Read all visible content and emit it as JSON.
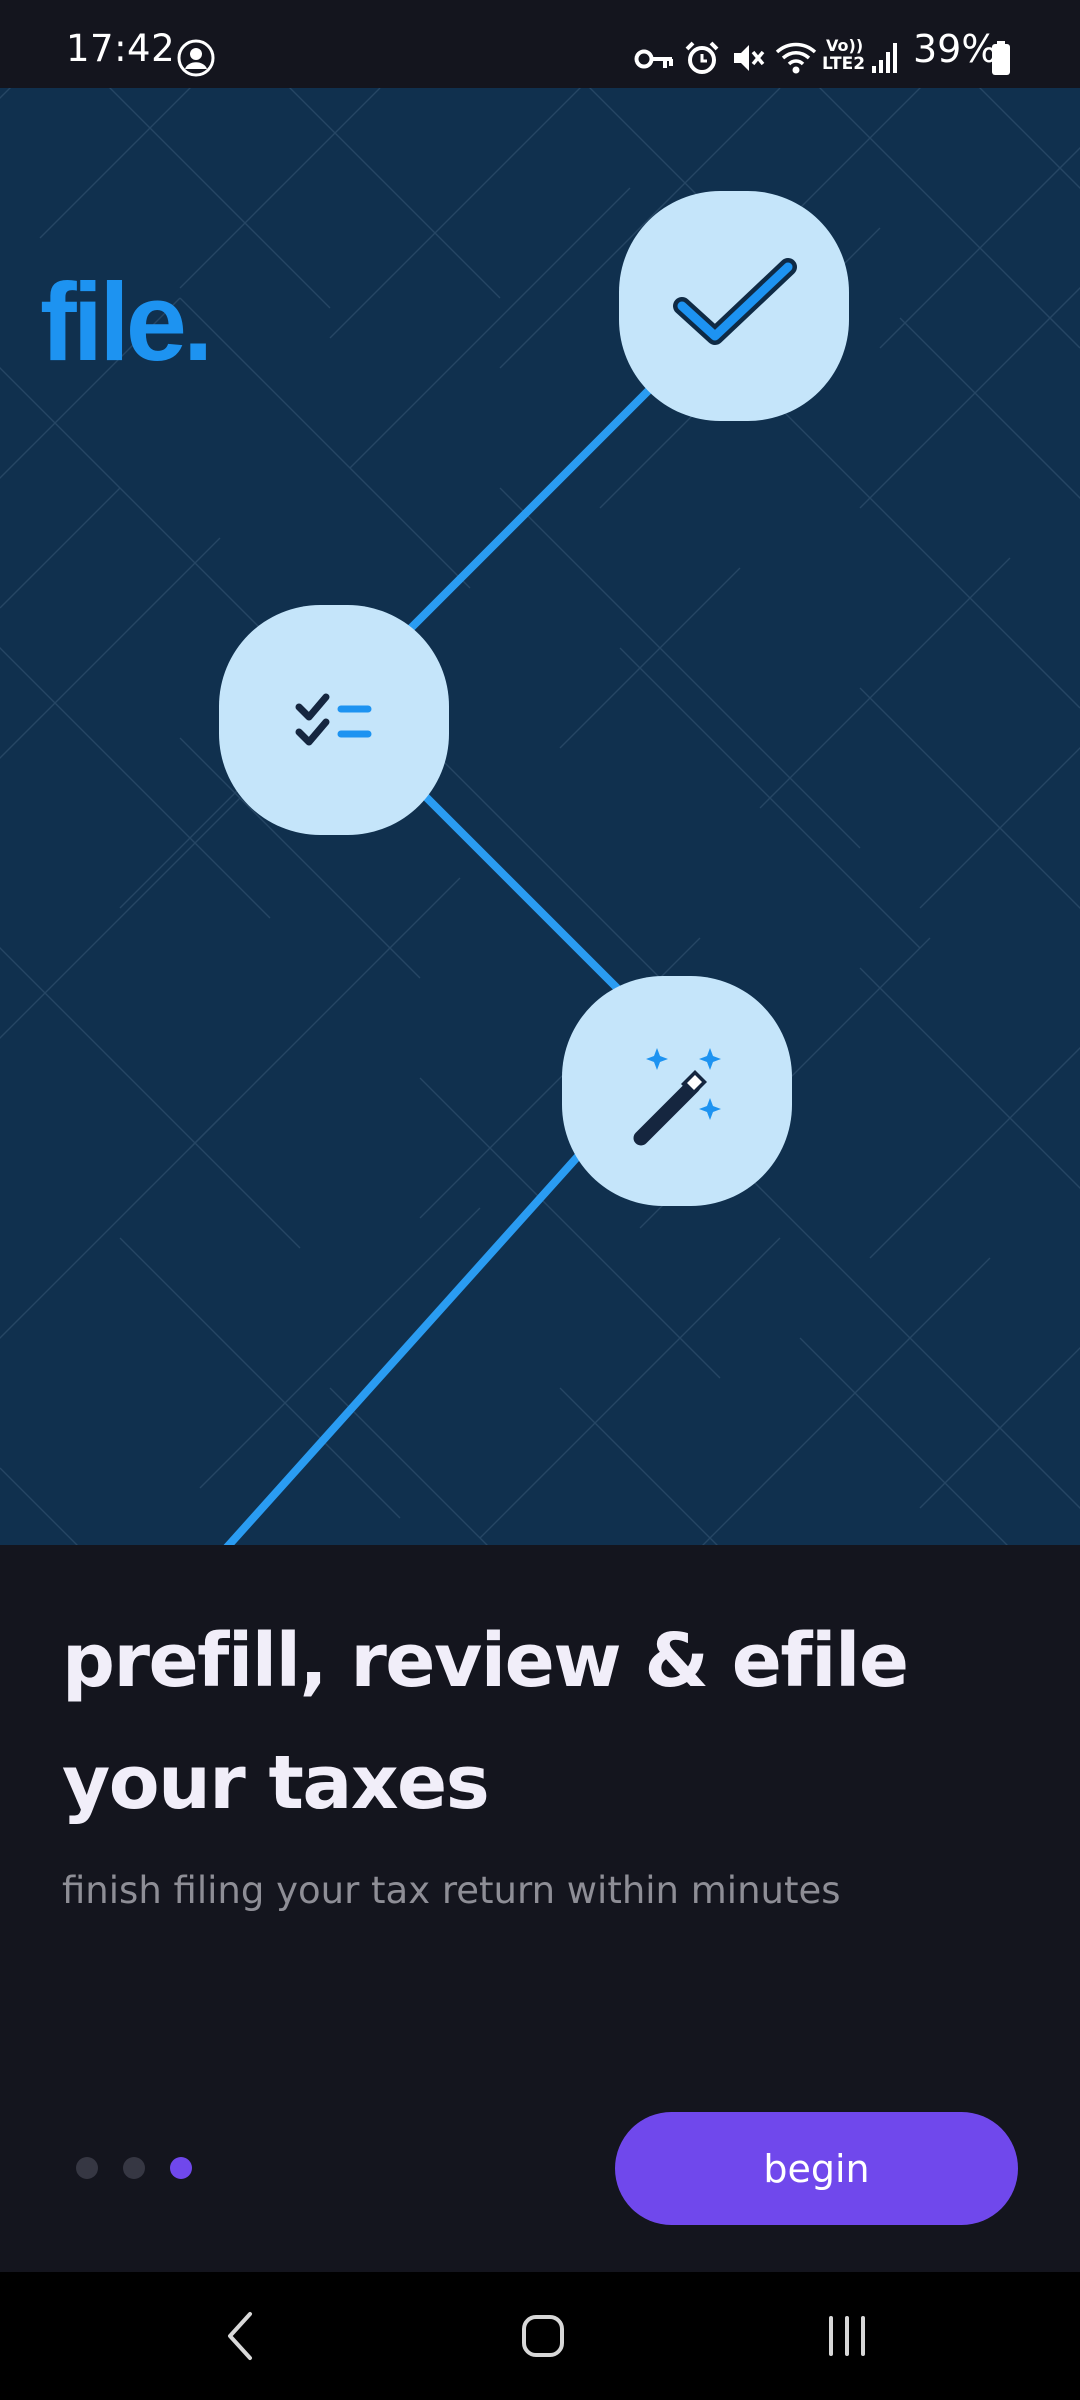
{
  "status_bar": {
    "time": "17:42",
    "battery": "39%",
    "icons": [
      "dnd-avatar-icon",
      "vpn-key-icon",
      "alarm-icon",
      "mute-icon",
      "wifi-icon",
      "volte-icon",
      "signal-icon",
      "battery-icon"
    ],
    "network_label_top": "Vo))",
    "network_label_bottom": "LTE2"
  },
  "hero": {
    "logo": "file.",
    "background_color": "#10304e",
    "path_color": "#2a9cf2",
    "bubble_color": "#c5e5fa",
    "steps": [
      {
        "icon": "checkmark-icon"
      },
      {
        "icon": "checklist-icon"
      },
      {
        "icon": "magic-wand-icon"
      }
    ]
  },
  "content": {
    "headline_line1": "prefill, review & efile",
    "headline_line2": "your taxes",
    "subtitle": "finish filing your tax return within minutes"
  },
  "pager": {
    "total": 3,
    "active_index": 2
  },
  "actions": {
    "begin_label": "begin"
  },
  "nav_bar": {
    "icons": [
      "back-icon",
      "home-icon",
      "recents-icon"
    ]
  },
  "colors": {
    "accent": "#7048ec",
    "brand_blue": "#1d93f1",
    "page_background": "#14151e"
  }
}
